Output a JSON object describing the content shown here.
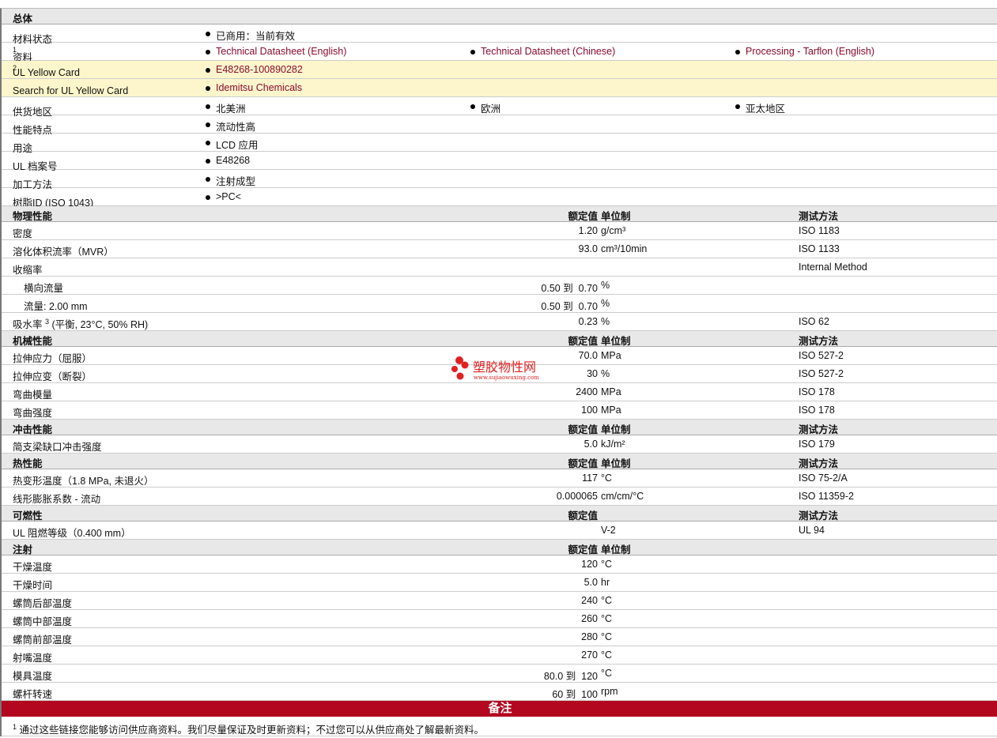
{
  "general": {
    "title": "总体",
    "rows": [
      {
        "label": "材料状态",
        "items": [
          "已商用：当前有效"
        ]
      },
      {
        "label": "资料",
        "sup": "1",
        "items": [
          "Technical Datasheet (English)",
          "Technical Datasheet (Chinese)",
          "Processing - Tarflon (English)"
        ],
        "links": true
      },
      {
        "label": "UL Yellow Card",
        "sup": "2",
        "items": [
          "E48268-100890282"
        ],
        "links": true,
        "highlight": true
      },
      {
        "label": "Search for UL Yellow Card",
        "items": [
          "Idemitsu Chemicals"
        ],
        "links": true,
        "highlight": true
      },
      {
        "label": "供货地区",
        "items": [
          "北美洲",
          "欧洲",
          "亚太地区"
        ]
      },
      {
        "label": "性能特点",
        "items": [
          "流动性高"
        ]
      },
      {
        "label": "用途",
        "items": [
          "LCD 应用"
        ]
      },
      {
        "label": "UL 档案号",
        "items": [
          "E48268"
        ]
      },
      {
        "label": "加工方法",
        "items": [
          "注射成型"
        ]
      },
      {
        "label": "树脂ID (ISO 1043)",
        "items": [
          ">PC<"
        ]
      }
    ]
  },
  "sections": [
    {
      "title": "物理性能",
      "h_value": "额定值",
      "h_unit": "单位制",
      "h_test": "测试方法",
      "rows": [
        {
          "label": "密度",
          "value": "1.20",
          "unit": "g/cm³",
          "test": "ISO 1183"
        },
        {
          "label": "溶化体积流率（MVR）",
          "value": "93.0",
          "unit": "cm³/10min",
          "test": "ISO 1133"
        },
        {
          "label": "收缩率",
          "value": "",
          "unit": "",
          "test": "Internal Method"
        },
        {
          "label": "横向流量",
          "value": "0.50 到  0.70",
          "unit": "%",
          "test": "",
          "sub": true
        },
        {
          "label": "流量: 2.00 mm",
          "value": "0.50 到  0.70",
          "unit": "%",
          "test": "",
          "sub": true
        },
        {
          "label": "吸水率",
          "sup": "3",
          "suffix": " (平衡, 23°C, 50% RH)",
          "value": "0.23",
          "unit": "%",
          "test": "ISO 62"
        }
      ]
    },
    {
      "title": "机械性能",
      "h_value": "额定值",
      "h_unit": "单位制",
      "h_test": "测试方法",
      "rows": [
        {
          "label": "拉伸应力（屈服）",
          "value": "70.0",
          "unit": "MPa",
          "test": "ISO 527-2"
        },
        {
          "label": "拉伸应变（断裂）",
          "value": "30",
          "unit": "%",
          "test": "ISO 527-2"
        },
        {
          "label": "弯曲模量",
          "value": "2400",
          "unit": "MPa",
          "test": "ISO 178"
        },
        {
          "label": "弯曲强度",
          "value": "100",
          "unit": "MPa",
          "test": "ISO 178"
        }
      ]
    },
    {
      "title": "冲击性能",
      "h_value": "额定值",
      "h_unit": "单位制",
      "h_test": "测试方法",
      "rows": [
        {
          "label": "简支梁缺口冲击强度",
          "value": "5.0",
          "unit": "kJ/m²",
          "test": "ISO 179"
        }
      ]
    },
    {
      "title": "热性能",
      "h_value": "额定值",
      "h_unit": "单位制",
      "h_test": "测试方法",
      "rows": [
        {
          "label": "热变形温度（1.8 MPa, 未退火）",
          "value": "117",
          "unit": "°C",
          "test": "ISO 75-2/A"
        },
        {
          "label": "线形膨胀系数  - 流动",
          "value": "0.000065",
          "unit": "cm/cm/°C",
          "test": "ISO 11359-2"
        }
      ]
    },
    {
      "title": "可燃性",
      "h_value": "额定值",
      "h_unit": "",
      "h_test": "测试方法",
      "rows": [
        {
          "label": "UL 阻燃等级（0.400 mm）",
          "value": "",
          "unit": "V-2",
          "test": "UL 94"
        }
      ]
    },
    {
      "title": "注射",
      "h_value": "额定值",
      "h_unit": "单位制",
      "h_test": "",
      "rows": [
        {
          "label": "干燥温度",
          "value": "120",
          "unit": "°C",
          "test": ""
        },
        {
          "label": "干燥时间",
          "value": "5.0",
          "unit": "hr",
          "test": ""
        },
        {
          "label": "螺筒后部温度",
          "value": "240",
          "unit": "°C",
          "test": ""
        },
        {
          "label": "螺筒中部温度",
          "value": "260",
          "unit": "°C",
          "test": ""
        },
        {
          "label": "螺筒前部温度",
          "value": "280",
          "unit": "°C",
          "test": ""
        },
        {
          "label": "射嘴温度",
          "value": "270",
          "unit": "°C",
          "test": ""
        },
        {
          "label": "模具温度",
          "value": "80.0 到  120",
          "unit": "°C",
          "test": ""
        },
        {
          "label": "螺杆转速",
          "value": "60 到  100",
          "unit": "rpm",
          "test": ""
        }
      ]
    }
  ],
  "notes": {
    "title": "备注",
    "footnote_num": "1",
    "footnote": "通过这些链接您能够访问供应商资料。我们尽量保证及时更新资料；不过您可以从供应商处了解最新资料。"
  },
  "watermark": {
    "name": "塑胶物性网",
    "url": "www.sujiaowuxing.com"
  }
}
